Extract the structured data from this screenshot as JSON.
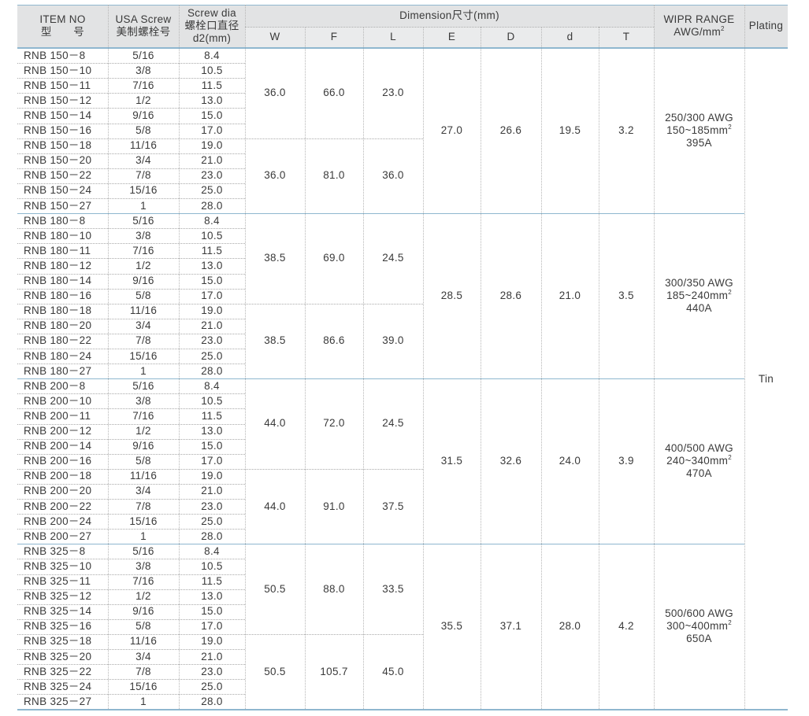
{
  "header": {
    "item_no_en": "ITEM NO",
    "item_no_cn": "型　　号",
    "usa_screw_en": "USA Screw",
    "usa_screw_cn": "美制螺栓号",
    "screw_dia_en": "Screw dia",
    "screw_dia_cn": "螺栓口直径",
    "screw_dia_unit": "d2(mm)",
    "dimension": "Dimension尺寸(mm)",
    "dims": [
      "W",
      "F",
      "L",
      "E",
      "D",
      "d",
      "T"
    ],
    "wipr_en": "WIPR RANGE",
    "wipr_unit": "AWG/mm",
    "wipr_unit_sup": "2",
    "plating": "Plating"
  },
  "plating_value": "Tin",
  "groups": [
    {
      "rows": [
        [
          "RNB 150－8",
          "5/16",
          "8.4"
        ],
        [
          "RNB 150－10",
          "3/8",
          "10.5"
        ],
        [
          "RNB 150－11",
          "7/16",
          "11.5"
        ],
        [
          "RNB 150－12",
          "1/2",
          "13.0"
        ],
        [
          "RNB 150－14",
          "9/16",
          "15.0"
        ],
        [
          "RNB 150－16",
          "5/8",
          "17.0"
        ],
        [
          "RNB 150－18",
          "11/16",
          "19.0"
        ],
        [
          "RNB 150－20",
          "3/4",
          "21.0"
        ],
        [
          "RNB 150－22",
          "7/8",
          "23.0"
        ],
        [
          "RNB 150－24",
          "15/16",
          "25.0"
        ],
        [
          "RNB 150－27",
          "1",
          "28.0"
        ]
      ],
      "upper": {
        "W": "36.0",
        "F": "66.0",
        "L": "23.0"
      },
      "lower": {
        "W": "36.0",
        "F": "81.0",
        "L": "36.0"
      },
      "E": "27.0",
      "D": "26.6",
      "d": "19.5",
      "T": "3.2",
      "wipr": [
        "250/300 AWG",
        "150~185mm",
        "395A"
      ]
    },
    {
      "rows": [
        [
          "RNB 180－8",
          "5/16",
          "8.4"
        ],
        [
          "RNB 180－10",
          "3/8",
          "10.5"
        ],
        [
          "RNB 180－11",
          "7/16",
          "11.5"
        ],
        [
          "RNB 180－12",
          "1/2",
          "13.0"
        ],
        [
          "RNB 180－14",
          "9/16",
          "15.0"
        ],
        [
          "RNB 180－16",
          "5/8",
          "17.0"
        ],
        [
          "RNB 180－18",
          "11/16",
          "19.0"
        ],
        [
          "RNB 180－20",
          "3/4",
          "21.0"
        ],
        [
          "RNB 180－22",
          "7/8",
          "23.0"
        ],
        [
          "RNB 180－24",
          "15/16",
          "25.0"
        ],
        [
          "RNB 180－27",
          "1",
          "28.0"
        ]
      ],
      "upper": {
        "W": "38.5",
        "F": "69.0",
        "L": "24.5"
      },
      "lower": {
        "W": "38.5",
        "F": "86.6",
        "L": "39.0"
      },
      "E": "28.5",
      "D": "28.6",
      "d": "21.0",
      "T": "3.5",
      "wipr": [
        "300/350 AWG",
        "185~240mm",
        "440A"
      ]
    },
    {
      "rows": [
        [
          "RNB 200－8",
          "5/16",
          "8.4"
        ],
        [
          "RNB 200－10",
          "3/8",
          "10.5"
        ],
        [
          "RNB 200－11",
          "7/16",
          "11.5"
        ],
        [
          "RNB 200－12",
          "1/2",
          "13.0"
        ],
        [
          "RNB 200－14",
          "9/16",
          "15.0"
        ],
        [
          "RNB 200－16",
          "5/8",
          "17.0"
        ],
        [
          "RNB 200－18",
          "11/16",
          "19.0"
        ],
        [
          "RNB 200－20",
          "3/4",
          "21.0"
        ],
        [
          "RNB 200－22",
          "7/8",
          "23.0"
        ],
        [
          "RNB 200－24",
          "15/16",
          "25.0"
        ],
        [
          "RNB 200－27",
          "1",
          "28.0"
        ]
      ],
      "upper": {
        "W": "44.0",
        "F": "72.0",
        "L": "24.5"
      },
      "lower": {
        "W": "44.0",
        "F": "91.0",
        "L": "37.5"
      },
      "E": "31.5",
      "D": "32.6",
      "d": "24.0",
      "T": "3.9",
      "wipr": [
        "400/500 AWG",
        "240~340mm",
        "470A"
      ]
    },
    {
      "rows": [
        [
          "RNB 325－8",
          "5/16",
          "8.4"
        ],
        [
          "RNB 325－10",
          "3/8",
          "10.5"
        ],
        [
          "RNB 325－11",
          "7/16",
          "11.5"
        ],
        [
          "RNB 325－12",
          "1/2",
          "13.0"
        ],
        [
          "RNB 325－14",
          "9/16",
          "15.0"
        ],
        [
          "RNB 325－16",
          "5/8",
          "17.0"
        ],
        [
          "RNB 325－18",
          "11/16",
          "19.0"
        ],
        [
          "RNB 325－20",
          "3/4",
          "21.0"
        ],
        [
          "RNB 325－22",
          "7/8",
          "23.0"
        ],
        [
          "RNB 325－24",
          "15/16",
          "25.0"
        ],
        [
          "RNB 325－27",
          "1",
          "28.0"
        ]
      ],
      "upper": {
        "W": "50.5",
        "F": "88.0",
        "L": "33.5"
      },
      "lower": {
        "W": "50.5",
        "F": "105.7",
        "L": "45.0"
      },
      "E": "35.5",
      "D": "37.1",
      "d": "28.0",
      "T": "4.2",
      "wipr": [
        "500/600 AWG",
        "300~400mm",
        "650A"
      ]
    }
  ]
}
